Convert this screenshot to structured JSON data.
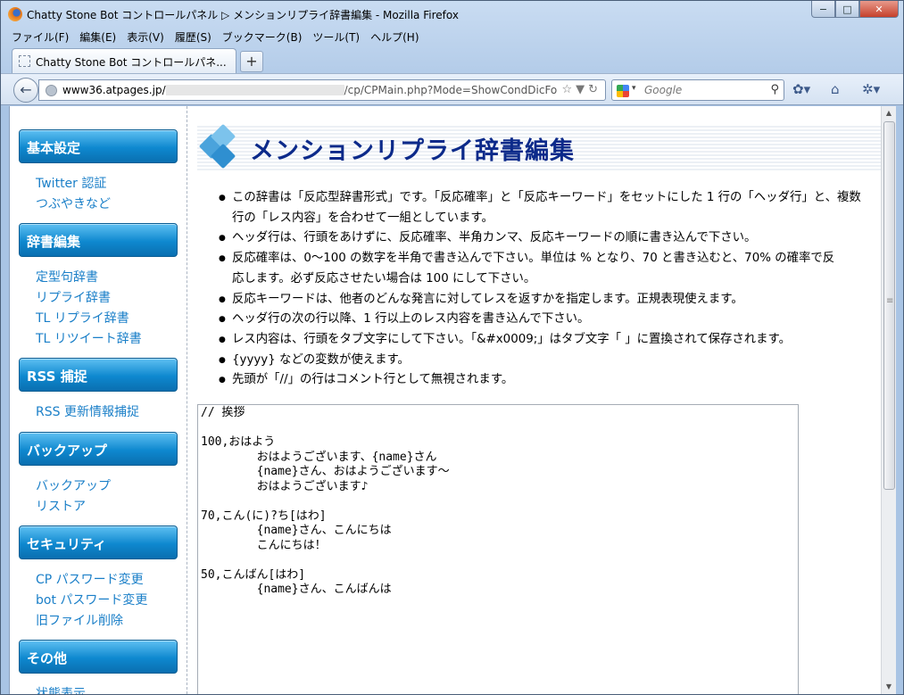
{
  "window": {
    "title": "Chatty Stone Bot コントロールパネル ▷ メンションリプライ辞書編集 - Mozilla Firefox",
    "buttons": {
      "minimize": "−",
      "maximize": "□",
      "close": "✕"
    }
  },
  "menu": [
    "ファイル(F)",
    "編集(E)",
    "表示(V)",
    "履歴(S)",
    "ブックマーク(B)",
    "ツール(T)",
    "ヘルプ(H)"
  ],
  "tab": {
    "label": "Chatty Stone Bot コントロールパネ...",
    "new_tab": "+"
  },
  "navbar": {
    "back": "←",
    "url_host": "www36.atpages.jp/",
    "url_path": "/cp/CPMain.php?Mode=ShowCondDicFo",
    "url_actions": "☆▼↻",
    "search_placeholder": "Google",
    "search_engine_dropdown": "▾",
    "search_go": "⚲"
  },
  "sidebar": {
    "sections": [
      {
        "title": "基本設定",
        "links": [
          "Twitter 認証",
          "つぶやきなど"
        ]
      },
      {
        "title": "辞書編集",
        "links": [
          "定型句辞書",
          "リプライ辞書",
          "TL リプライ辞書",
          "TL リツイート辞書"
        ]
      },
      {
        "title": "RSS 捕捉",
        "links": [
          "RSS 更新情報捕捉"
        ]
      },
      {
        "title": "バックアップ",
        "links": [
          "バックアップ",
          "リストア"
        ]
      },
      {
        "title": "セキュリティ",
        "links": [
          "CP パスワード変更",
          "bot パスワード変更",
          "旧ファイル削除"
        ]
      },
      {
        "title": "その他",
        "links": [
          "状態表示"
        ]
      }
    ]
  },
  "main": {
    "heading": "メンションリプライ辞書編集",
    "rules": [
      "この辞書は「反応型辞書形式」です。「反応確率」と「反応キーワード」をセットにした 1 行の「ヘッダ行」と、複数",
      "行の「レス内容」を合わせて一組としています。",
      "ヘッダ行は、行頭をあけずに、反応確率、半角カンマ、反応キーワードの順に書き込んで下さい。",
      "反応確率は、0〜100 の数字を半角で書き込んで下さい。単位は % となり、70 と書き込むと、70% の確率で反",
      "応します。必ず反応させたい場合は 100 にして下さい。",
      "反応キーワードは、他者のどんな発言に対してレスを返すかを指定します。正規表現使えます。",
      "ヘッダ行の次の行以降、1 行以上のレス内容を書き込んで下さい。",
      "レス内容は、行頭をタブ文字にして下さい。「&#x0009;」はタブ文字「 」に置換されて保存されます。",
      "{yyyy} などの変数が使えます。",
      "先頭が「//」の行はコメント行として無視されます。"
    ],
    "editor_text": "// 挨拶\n\n100,おはよう\n        おはようございます、{name}さん\n        {name}さん、おはようございます～\n        おはようございます♪\n\n70,こん(に)?ち[はわ]\n        {name}さん、こんにちは\n        こんにちは！\n\n50,こんばん[はわ]\n        {name}さん、こんばんは"
  },
  "toolbar_icons": [
    "addon-icon",
    "home-icon",
    "settings-icon"
  ],
  "colors": {
    "sidebar_header": "#0e88cf",
    "link": "#1a7fc8",
    "heading": "#0c2a8a"
  }
}
